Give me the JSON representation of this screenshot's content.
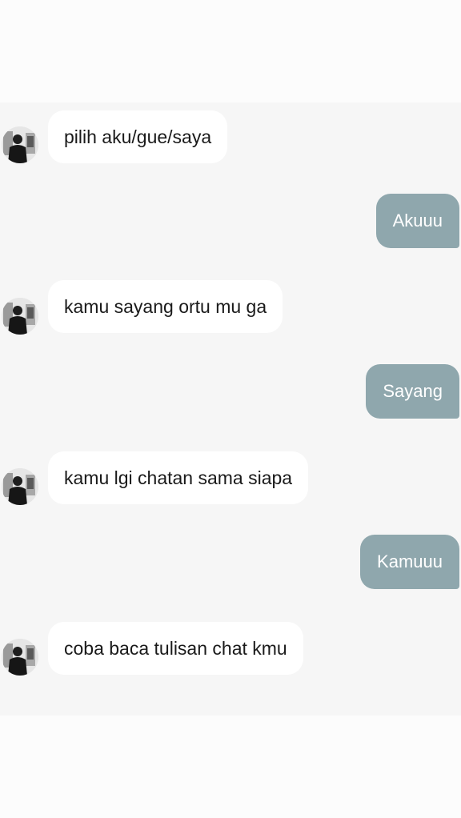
{
  "conversation": {
    "messages": [
      {
        "sender": "them",
        "text": "pilih aku/gue/saya"
      },
      {
        "sender": "me",
        "text": "Akuuu"
      },
      {
        "sender": "them",
        "text": "kamu sayang ortu mu ga"
      },
      {
        "sender": "me",
        "text": "Sayang"
      },
      {
        "sender": "them",
        "text": "kamu lgi chatan sama siapa"
      },
      {
        "sender": "me",
        "text": "Kamuuu"
      },
      {
        "sender": "them",
        "text": "coba baca tulisan chat kmu"
      }
    ]
  },
  "colors": {
    "background": "#f6f6f6",
    "incoming_bubble": "#ffffff",
    "outgoing_bubble": "#8fa7ad",
    "outgoing_text": "#ffffff",
    "incoming_text": "#1a1a1a"
  },
  "icons": {
    "avatar": "profile-photo-icon"
  }
}
